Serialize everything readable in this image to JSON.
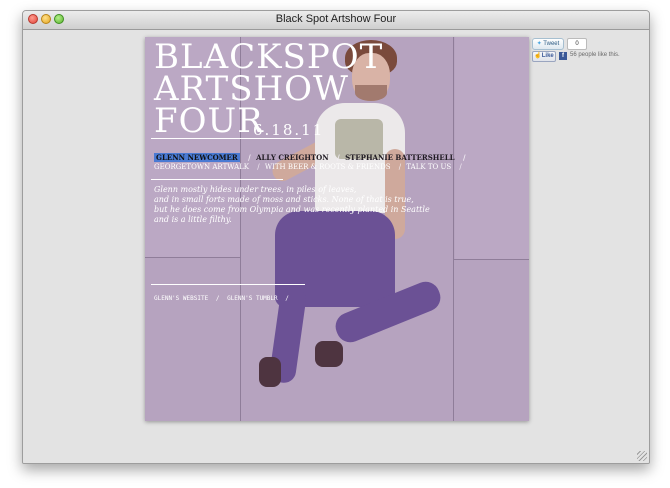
{
  "window": {
    "title": "Black Spot Artshow Four"
  },
  "poster": {
    "title_lines": [
      "BLACKSPOT",
      "ARTSHOW",
      "FOUR"
    ],
    "date": "6.18.11",
    "nav_row1": [
      "GLENN NEWCOMER",
      "ALLY CREIGHTON",
      "STEPHANIE BATTERSHELL"
    ],
    "nav_row2": [
      "GEORGETOWN ARTWALK",
      "WITH BEER & ROOTS & FRIENDS",
      "TALK TO US"
    ],
    "separator": "/",
    "bio_lines": [
      "Glenn mostly hides under trees, in piles of leaves,",
      "and in small forts made of moss and sticks. None of that is true,",
      "but he does come from Olympia and was recently planted in Seattle",
      "and is a little filthy."
    ],
    "links": [
      "GLENN'S WEBSITE",
      "GLENN'S TUMBLR"
    ]
  },
  "social": {
    "tweet_label": "Tweet",
    "tweet_count": "0",
    "like_label": "Like",
    "fb_letter": "f",
    "like_text": "56 people like this."
  }
}
